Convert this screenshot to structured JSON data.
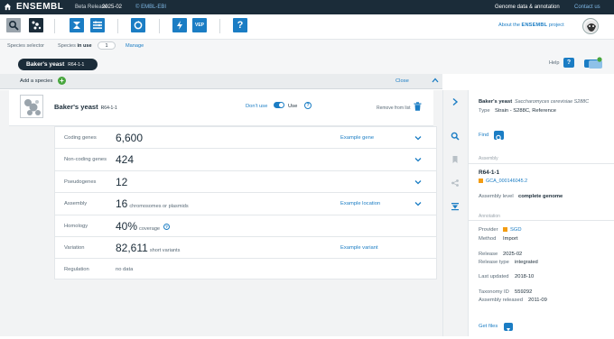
{
  "topbar": {
    "brand": "ENSEMBL",
    "beta_label": "Beta Release",
    "version": "2025-02",
    "org": "© EMBL-EBI",
    "section": "Genome data & annotation",
    "contact": "Contact us"
  },
  "toolbar": {
    "tools": [
      "search-icon",
      "species-selector-icon",
      "genome-browser-icon",
      "entity-viewer-icon",
      "blast-icon",
      "tools-icon",
      "vep-icon",
      "help-icon"
    ],
    "vep_label": "VEP",
    "help_glyph": "?",
    "about_prefix": "About the",
    "about_brand": "ENSEMBL",
    "about_suffix": "project"
  },
  "species_bar": {
    "selector_label": "Species selector",
    "in_use_prefix": "Species",
    "in_use_bold": "in use",
    "count": "1",
    "manage": "Manage",
    "selected_name": "Baker's yeast",
    "selected_assembly": "R64-1-1",
    "help_label": "Help",
    "help_glyph": "?"
  },
  "add_bar": {
    "label": "Add a species",
    "add_glyph": "+",
    "close": "Close"
  },
  "species_card": {
    "name": "Baker's yeast",
    "assembly": "R64-1-1",
    "dont_use": "Don't use",
    "use": "Use",
    "help_glyph": "?",
    "remove": "Remove from list"
  },
  "stats": [
    {
      "label": "Coding genes",
      "value": "6,600",
      "unit": "",
      "link": "Example gene",
      "expandable": true
    },
    {
      "label": "Non-coding genes",
      "value": "424",
      "unit": "",
      "link": "",
      "expandable": true
    },
    {
      "label": "Pseudogenes",
      "value": "12",
      "unit": "",
      "link": "",
      "expandable": true
    },
    {
      "label": "Assembly",
      "value": "16",
      "unit": "chromosomes or plasmids",
      "link": "Example location",
      "expandable": true
    },
    {
      "label": "Homology",
      "value": "40%",
      "unit": "coverage",
      "link": "",
      "expandable": false,
      "help": "?"
    },
    {
      "label": "Variation",
      "value": "82,611",
      "unit": "short variants",
      "link": "Example variant",
      "expandable": false
    },
    {
      "label": "Regulation",
      "value": "",
      "unit": "no data",
      "link": "",
      "expandable": false
    }
  ],
  "right_panel": {
    "species_name": "Baker's yeast",
    "scientific_name": "Saccharomyces cerevisiae S288C",
    "type_label": "Type",
    "type_value": "Strain - S288C, Reference",
    "find": "Find",
    "assembly_section": "Assembly",
    "assembly_name": "R64-1-1",
    "accession": "GCA_000146045.2",
    "assembly_level_label": "Assembly level",
    "assembly_level_value": "complete genome",
    "annotation_section": "Annotation",
    "provider_label": "Provider",
    "provider_value": "SGD",
    "method_label": "Method",
    "method_value": "Import",
    "release_label": "Release",
    "release_value": "2025-02",
    "release_type_label": "Release type",
    "release_type_value": "integrated",
    "last_updated_label": "Last updated",
    "last_updated_value": "2018-10",
    "taxonomy_label": "Taxonomy ID",
    "taxonomy_value": "559292",
    "assembly_released_label": "Assembly released",
    "assembly_released_value": "2011-09",
    "get_files": "Get files"
  },
  "colors": {
    "navy": "#1b2c39",
    "link_blue": "#1b7dc4",
    "green": "#47a63d",
    "panel_grey": "#f2f3f4"
  }
}
